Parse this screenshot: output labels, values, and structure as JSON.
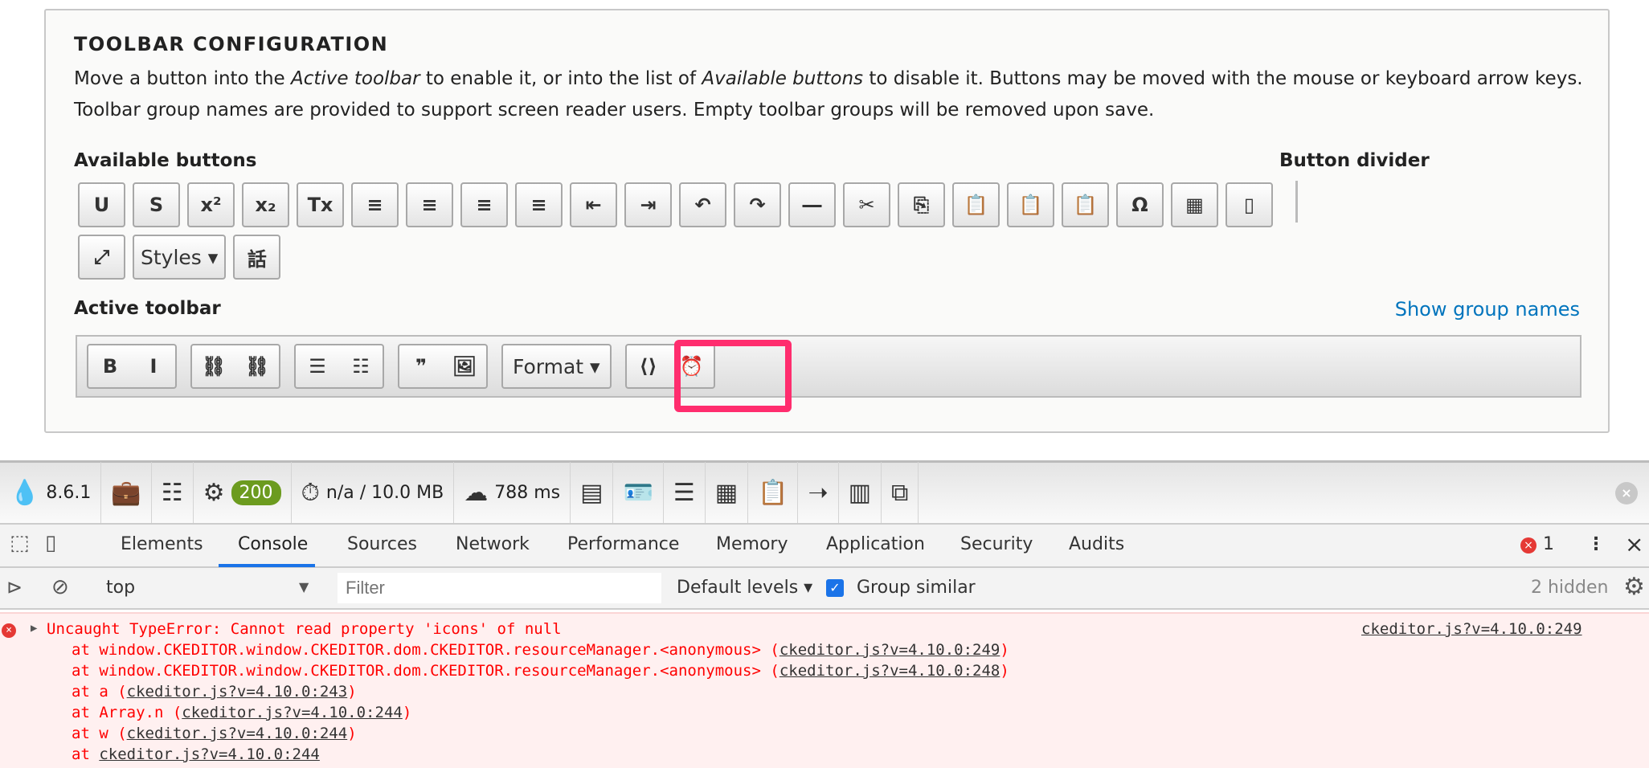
{
  "panel": {
    "title": "TOOLBAR CONFIGURATION",
    "desc": [
      "Move a button into the ",
      "Active toolbar",
      " to enable it, or into the list of ",
      "Available buttons",
      " to disable it. Buttons may be moved with the mouse or keyboard arrow keys. Toolbar group names are provided to support screen reader users. Empty toolbar groups will be removed upon save."
    ],
    "available_label": "Available buttons",
    "divider_label": "Button divider",
    "active_label": "Active toolbar",
    "show_group_names": "Show group names"
  },
  "available_row1": [
    "U",
    "S",
    "x²",
    "x₂",
    "Tx",
    "≡",
    "≡",
    "≡",
    "≡",
    "⇤",
    "⇥",
    "↶",
    "↷",
    "―",
    "✂",
    "⎘",
    "📋",
    "📋",
    "📋",
    "Ω",
    "▦",
    "▯"
  ],
  "available_row2": [
    "⤢",
    "Styles ▾",
    "話"
  ],
  "active_groups": [
    [
      "B",
      "I"
    ],
    [
      "⛓",
      "⛓"
    ],
    [
      "☰",
      "☷"
    ],
    [
      "❞",
      "🖼"
    ],
    [
      "Format ▾"
    ],
    [
      "⟨⟩",
      "⏰"
    ]
  ],
  "drupal": {
    "version": "8.6.1",
    "status": "200",
    "memory": "n/a / 10.0 MB",
    "time": "788 ms"
  },
  "devtools": {
    "tabs": [
      "Elements",
      "Console",
      "Sources",
      "Network",
      "Performance",
      "Memory",
      "Application",
      "Security",
      "Audits"
    ],
    "error_count": "1",
    "context": "top",
    "filter_placeholder": "Filter",
    "levels": "Default levels ▾",
    "group_similar": "Group similar",
    "hidden": "2 hidden"
  },
  "error": {
    "message": "Uncaught TypeError: Cannot read property 'icons' of null",
    "source": "ckeditor.js?v=4.10.0:249",
    "stack": [
      {
        "pre": "at window.CKEDITOR.window.CKEDITOR.dom.CKEDITOR.resourceManager.<anonymous> (",
        "link": "ckeditor.js?v=4.10.0:249",
        "post": ")"
      },
      {
        "pre": "at window.CKEDITOR.window.CKEDITOR.dom.CKEDITOR.resourceManager.<anonymous> (",
        "link": "ckeditor.js?v=4.10.0:248",
        "post": ")"
      },
      {
        "pre": "at a (",
        "link": "ckeditor.js?v=4.10.0:243",
        "post": ")"
      },
      {
        "pre": "at Array.n (",
        "link": "ckeditor.js?v=4.10.0:244",
        "post": ")"
      },
      {
        "pre": "at w (",
        "link": "ckeditor.js?v=4.10.0:244",
        "post": ")"
      },
      {
        "pre": "at ",
        "link": "ckeditor.js?v=4.10.0:244",
        "post": ""
      }
    ]
  }
}
